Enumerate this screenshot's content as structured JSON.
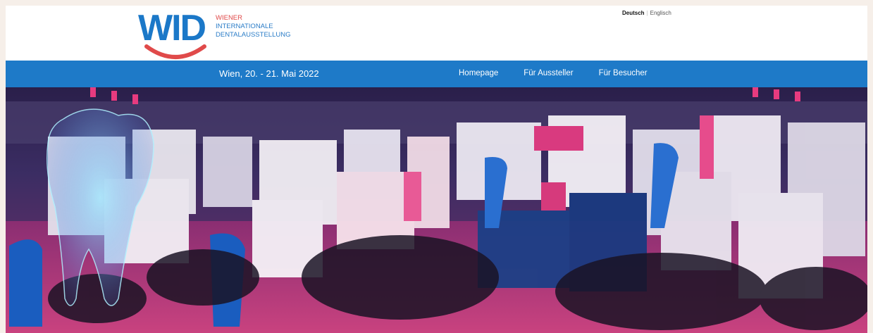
{
  "logo": {
    "letters": "WID",
    "line1": "WIENER",
    "line2": "INTERNATIONALE",
    "line3": "DENTALAUSSTELLUNG"
  },
  "language": {
    "active": "Deutsch",
    "separator": "|",
    "other": "Englisch"
  },
  "nav": {
    "date": "Wien, 20. - 21. Mai 2022",
    "items": [
      "Homepage",
      "Für Aussteller",
      "Für Besucher"
    ]
  },
  "colors": {
    "brand_blue": "#1e7ac8",
    "brand_red": "#e04a4a",
    "frame_bg": "#f6efe9"
  },
  "hero": {
    "description_icon": "trade-fair-hall-photo"
  }
}
